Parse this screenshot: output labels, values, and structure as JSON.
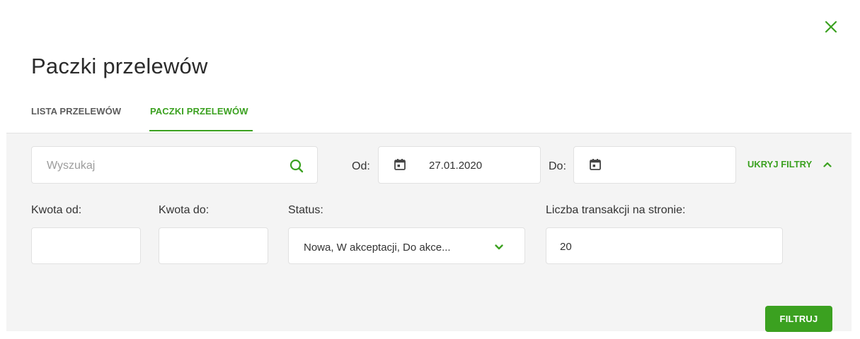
{
  "modal": {
    "title": "Paczki przelewów",
    "close_icon": "close-icon"
  },
  "tabs": [
    {
      "label": "LISTA PRZELEWÓW",
      "active": false
    },
    {
      "label": "PACZKI PRZELEWÓW",
      "active": true
    }
  ],
  "filters": {
    "search": {
      "placeholder": "Wyszukaj",
      "value": "",
      "icon": "search-icon"
    },
    "date_from": {
      "label": "Od:",
      "value": "27.01.2020",
      "icon": "calendar-icon"
    },
    "date_to": {
      "label": "Do:",
      "value": "",
      "icon": "calendar-icon"
    },
    "toggle_label": "UKRYJ FILTRY",
    "toggle_icon": "chevron-up-icon",
    "amount_from": {
      "label": "Kwota od:",
      "value": ""
    },
    "amount_to": {
      "label": "Kwota do:",
      "value": ""
    },
    "status": {
      "label": "Status:",
      "value": "Nowa, W akceptacji, Do akce...",
      "icon": "chevron-down-icon"
    },
    "per_page": {
      "label": "Liczba transakcji na stronie:",
      "value": "20"
    },
    "submit_label": "FILTRUJ"
  },
  "colors": {
    "accent": "#3ba120",
    "panel_bg": "#f4f4f4",
    "border": "#e1e1e1"
  }
}
